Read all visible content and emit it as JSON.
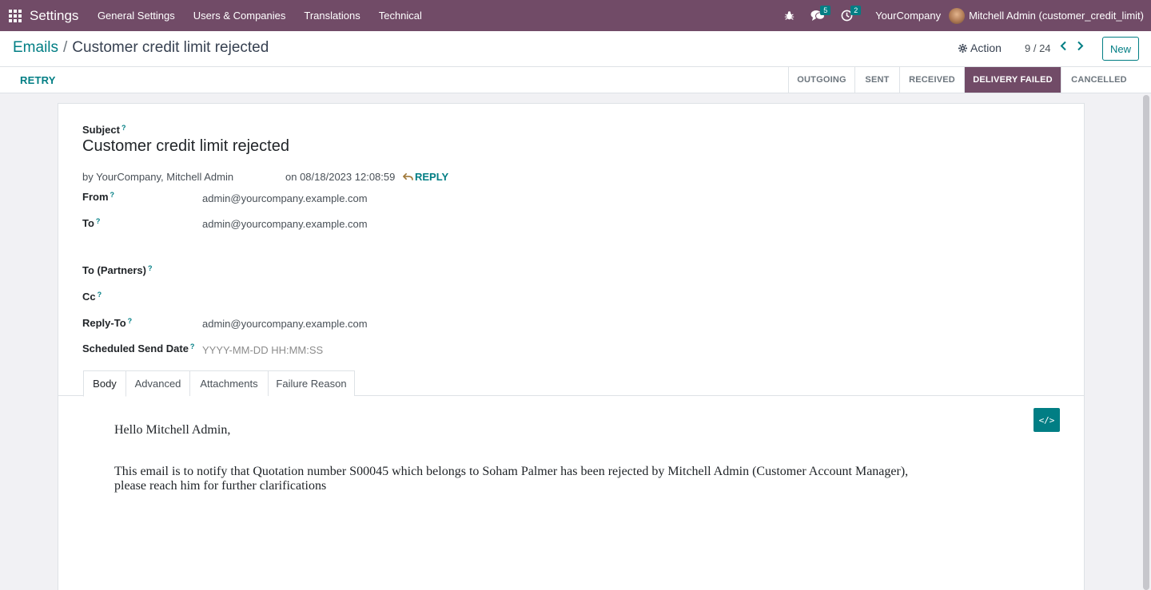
{
  "navbar": {
    "brand": "Settings",
    "menu": [
      "General Settings",
      "Users & Companies",
      "Translations",
      "Technical"
    ],
    "messages_count": "5",
    "activities_count": "2",
    "company": "YourCompany",
    "user": "Mitchell Admin (customer_credit_limit)",
    "accent": "#714b67"
  },
  "control": {
    "breadcrumb_parent": "Emails",
    "breadcrumb_sep": "/",
    "breadcrumb_current": "Customer credit limit rejected",
    "action_label": "Action",
    "pager": "9 / 24",
    "new_label": "New"
  },
  "statusbar": {
    "retry_label": "RETRY",
    "stages": [
      "OUTGOING",
      "SENT",
      "RECEIVED",
      "DELIVERY FAILED",
      "CANCELLED"
    ],
    "active_stage": "DELIVERY FAILED"
  },
  "form": {
    "subject_label": "Subject",
    "subject": "Customer credit limit rejected",
    "byline": "by YourCompany, Mitchell Admin",
    "date": "on 08/18/2023 12:08:59",
    "reply_label": "REPLY",
    "from_label": "From",
    "from": "admin@yourcompany.example.com",
    "to_label": "To",
    "to": "admin@yourcompany.example.com",
    "to_partners_label": "To (Partners)",
    "to_partners": "",
    "cc_label": "Cc",
    "cc": "",
    "reply_to_label": "Reply-To",
    "reply_to": "admin@yourcompany.example.com",
    "scheduled_label": "Scheduled Send Date",
    "scheduled_placeholder": "YYYY-MM-DD HH:MM:SS",
    "help_mark": "?"
  },
  "tabs": [
    "Body",
    "Advanced",
    "Attachments",
    "Failure Reason"
  ],
  "body": {
    "greeting": "Hello Mitchell Admin,",
    "message": "This email is to notify that Quotation number S00045 which belongs to Soham Palmer has been rejected by Mitchell Admin (Customer Account Manager), please reach him for further clarifications"
  },
  "icons": {
    "apps": "apps-grid-icon",
    "bug": "bug-icon",
    "chat": "chat-icon",
    "clock": "clock-icon",
    "gear": "gear-icon",
    "prev": "chevron-left-icon",
    "next": "chevron-right-icon",
    "reply": "reply-arrow-icon",
    "code": "code-view-icon"
  }
}
